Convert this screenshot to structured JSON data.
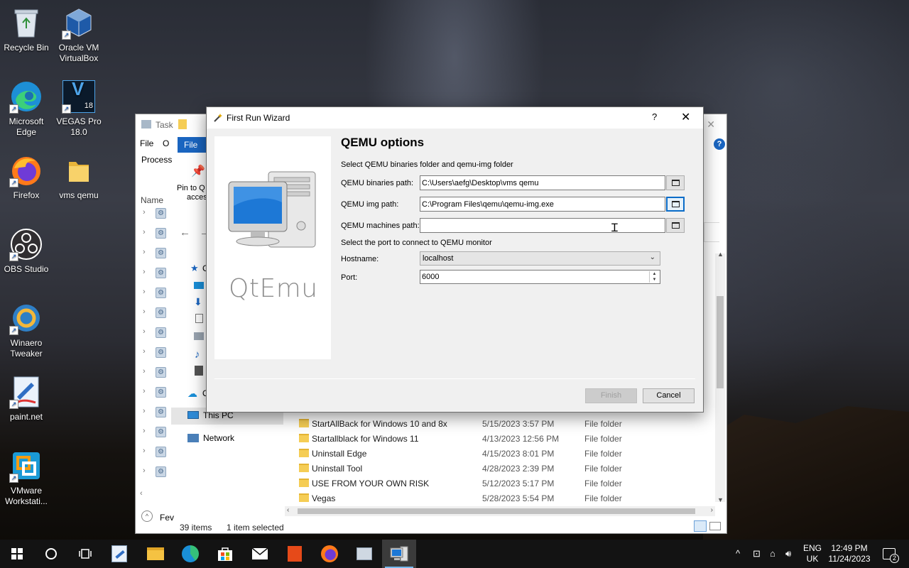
{
  "desktop": {
    "icons": [
      {
        "label": "Recycle Bin",
        "icon": "recycle-bin-icon"
      },
      {
        "label": "Oracle VM VirtualBox",
        "icon": "virtualbox-icon"
      },
      {
        "label": "Microsoft Edge",
        "icon": "edge-icon"
      },
      {
        "label": "VEGAS Pro 18.0",
        "icon": "vegas-icon"
      },
      {
        "label": "Firefox",
        "icon": "firefox-icon"
      },
      {
        "label": "vms qemu",
        "icon": "folder-icon"
      },
      {
        "label": "OBS Studio",
        "icon": "obs-icon"
      },
      {
        "label": "Winaero Tweaker",
        "icon": "winaero-icon"
      },
      {
        "label": "paint.net",
        "icon": "paintnet-icon"
      },
      {
        "label": "VMware Workstati...",
        "icon": "vmware-icon"
      }
    ],
    "vegas_badge": "18"
  },
  "explorer": {
    "title_partial": "Task",
    "menu_file": "File",
    "menu_o": "O",
    "ribbon_file_tab": "File",
    "process_partial": "Process",
    "pin_partial_1": "Pin to Q",
    "pin_partial_2": "acces",
    "name_header_partial": "Name",
    "nav": {
      "onedrive_partial": "O",
      "quick_access_partial": "C",
      "this_pc": "This PC",
      "network": "Network"
    },
    "files": [
      {
        "name": "StartAllBack for Windows 10 and 8x",
        "date": "5/15/2023 3:57 PM",
        "type": "File folder"
      },
      {
        "name": "Startallblack for Windows 11",
        "date": "4/13/2023 12:56 PM",
        "type": "File folder"
      },
      {
        "name": "Uninstall Edge",
        "date": "4/15/2023 8:01 PM",
        "type": "File folder"
      },
      {
        "name": "Uninstall Tool",
        "date": "4/28/2023 2:39 PM",
        "type": "File folder"
      },
      {
        "name": "USE FROM YOUR OWN RISK",
        "date": "5/12/2023 5:17 PM",
        "type": "File folder"
      },
      {
        "name": "Vegas",
        "date": "5/28/2023 5:54 PM",
        "type": "File folder"
      }
    ],
    "status_items": "39 items",
    "status_selected": "1 item selected",
    "fewer_details_partial": "Fev"
  },
  "wizard": {
    "title": "First Run Wizard",
    "help_glyph": "?",
    "close_glyph": "✕",
    "brand": "QtEmu",
    "page_title": "QEMU options",
    "section1": "Select QEMU binaries folder and qemu-img folder",
    "binaries_label": "QEMU binaries path:",
    "binaries_value": "C:\\Users\\aefg\\Desktop\\vms qemu",
    "img_label": "QEMU img path:",
    "img_value": "C:\\Program Files\\qemu\\qemu-img.exe",
    "machines_label": "QEMU machines path:",
    "machines_value": "",
    "section2": "Select the port to connect to QEMU monitor",
    "hostname_label": "Hostname:",
    "hostname_value": "localhost",
    "port_label": "Port:",
    "port_value": "6000",
    "finish_label": "Finish",
    "cancel_label": "Cancel"
  },
  "taskbar": {
    "lang_1": "ENG",
    "lang_2": "UK",
    "time": "12:49 PM",
    "date": "11/24/2023",
    "notification_count": "2"
  }
}
